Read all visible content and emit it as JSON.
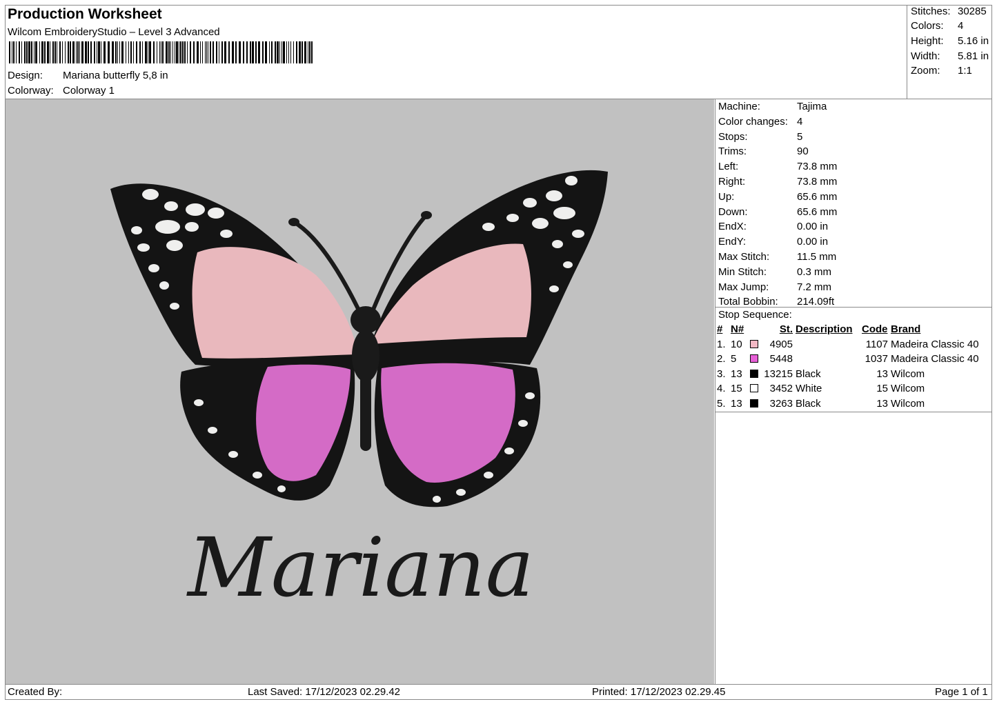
{
  "header": {
    "title": "Production Worksheet",
    "software": "Wilcom EmbroideryStudio – Level 3 Advanced",
    "design_label": "Design:",
    "design_value": "Mariana butterfly 5,8 in",
    "colorway_label": "Colorway:",
    "colorway_value": "Colorway 1"
  },
  "stats": [
    {
      "label": "Stitches:",
      "value": "30285"
    },
    {
      "label": "Colors:",
      "value": "4"
    },
    {
      "label": "Height:",
      "value": "5.16 in"
    },
    {
      "label": "Width:",
      "value": "5.81 in"
    },
    {
      "label": "Zoom:",
      "value": "1:1"
    }
  ],
  "specs": [
    {
      "label": "Machine:",
      "value": "Tajima"
    },
    {
      "label": "Color changes:",
      "value": "4"
    },
    {
      "label": "Stops:",
      "value": "5"
    },
    {
      "label": "Trims:",
      "value": "90"
    },
    {
      "label": "Left:",
      "value": "73.8 mm"
    },
    {
      "label": "Right:",
      "value": "73.8 mm"
    },
    {
      "label": "Up:",
      "value": "65.6 mm"
    },
    {
      "label": "Down:",
      "value": "65.6 mm"
    },
    {
      "label": "EndX:",
      "value": "0.00 in"
    },
    {
      "label": "EndY:",
      "value": "0.00 in"
    },
    {
      "label": "Max Stitch:",
      "value": "11.5 mm"
    },
    {
      "label": "Min Stitch:",
      "value": "0.3 mm"
    },
    {
      "label": "Max Jump:",
      "value": "7.2 mm"
    },
    {
      "label": "Total Bobbin:",
      "value": "214.09ft"
    }
  ],
  "stop_sequence": {
    "title": "Stop Sequence:",
    "headers": {
      "num": "#",
      "needle": "N#",
      "stitches": "St.",
      "description": "Description",
      "code": "Code",
      "brand": "Brand"
    },
    "rows": [
      {
        "num": "1.",
        "needle": "10",
        "color": "#f2b8c4",
        "stitches": "4905",
        "description": "",
        "code": "1107",
        "brand": "Madeira Classic 40"
      },
      {
        "num": "2.",
        "needle": "5",
        "color": "#e65fd6",
        "stitches": "5448",
        "description": "",
        "code": "1037",
        "brand": "Madeira Classic 40"
      },
      {
        "num": "3.",
        "needle": "13",
        "color": "#000000",
        "stitches": "13215",
        "description": "Black",
        "code": "13",
        "brand": "Wilcom"
      },
      {
        "num": "4.",
        "needle": "15",
        "color": "#ffffff",
        "stitches": "3452",
        "description": "White",
        "code": "15",
        "brand": "Wilcom"
      },
      {
        "num": "5.",
        "needle": "13",
        "color": "#000000",
        "stitches": "3263",
        "description": "Black",
        "code": "13",
        "brand": "Wilcom"
      }
    ]
  },
  "preview": {
    "name_text": "Mariana",
    "background": "#c1c1c1"
  },
  "footer": {
    "created_by": "Created By:",
    "last_saved": "Last Saved: 17/12/2023 02.29.42",
    "printed": "Printed: 17/12/2023 02.29.45",
    "page": "Page 1 of 1"
  }
}
